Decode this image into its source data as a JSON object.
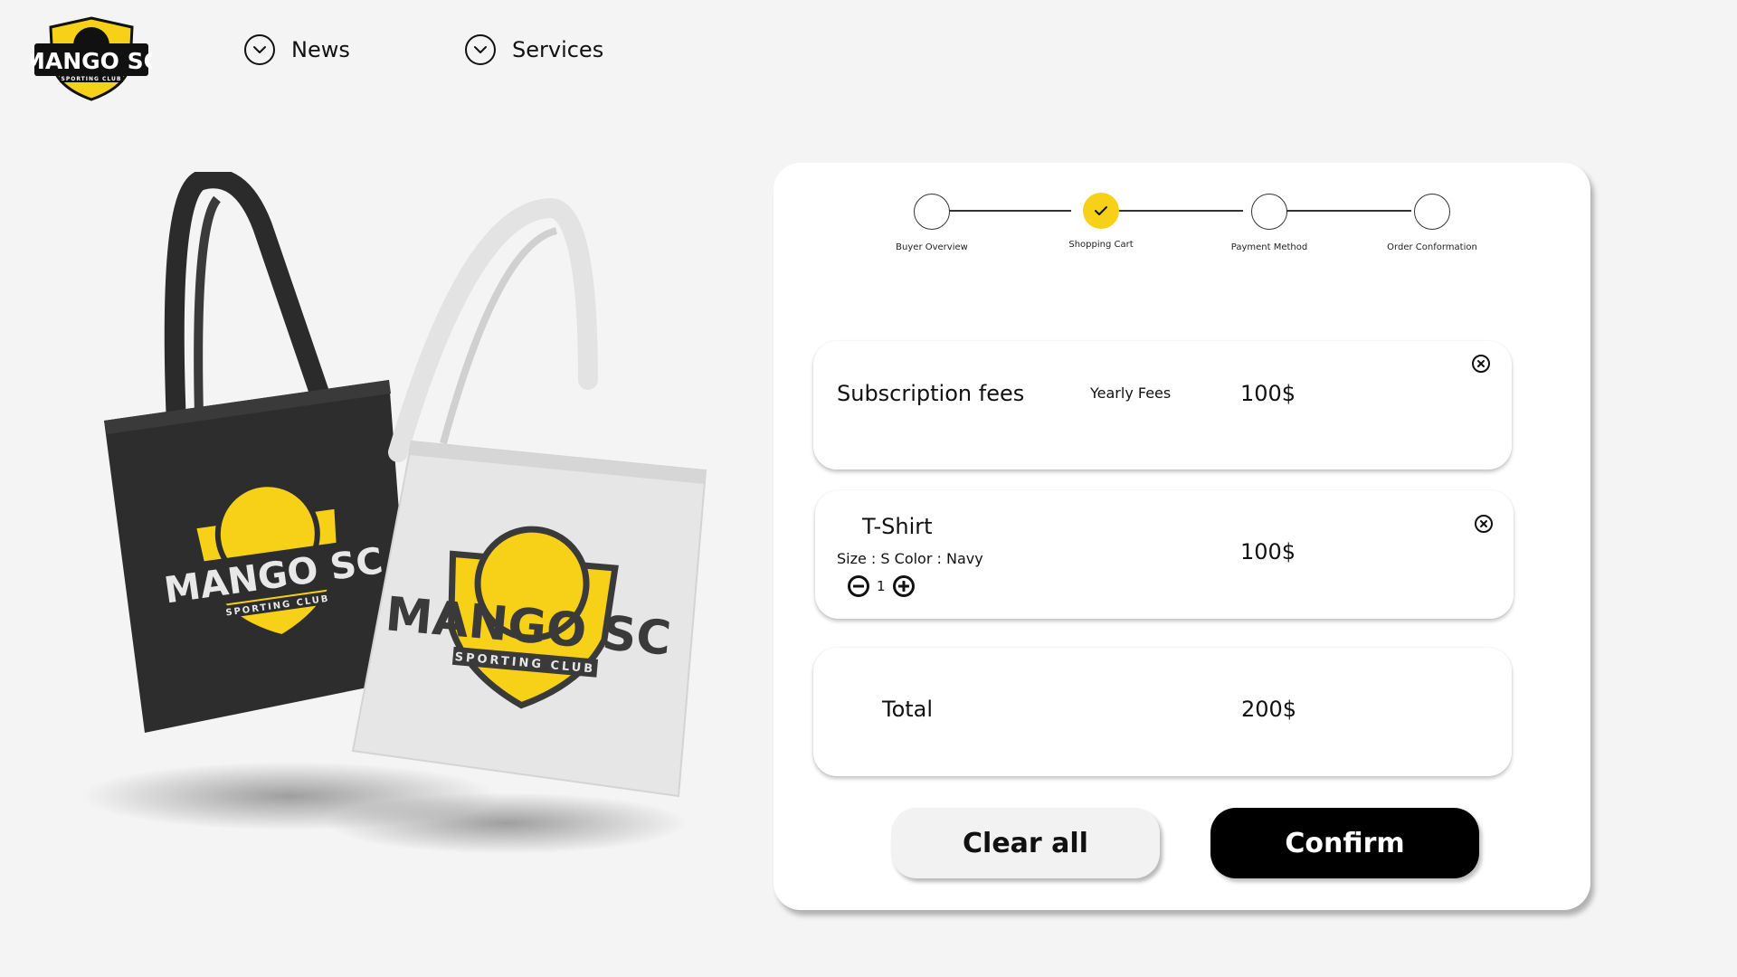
{
  "brand": {
    "logo_text": "MANGO SC",
    "logo_subtext": "SPORTING CLUB",
    "accent": "#f7d117"
  },
  "nav": {
    "items": [
      {
        "label": "News",
        "icon": "chevron-down-icon"
      },
      {
        "label": "Services",
        "icon": "chevron-down-icon"
      }
    ]
  },
  "stepper": {
    "steps": [
      {
        "label": "Buyer Overview",
        "state": "pending"
      },
      {
        "label": "Shopping Cart",
        "state": "active"
      },
      {
        "label": "Payment Method",
        "state": "pending"
      },
      {
        "label": "Order Conformation",
        "state": "pending"
      }
    ]
  },
  "cart": {
    "items": [
      {
        "name": "Subscription fees",
        "detail": "Yearly Fees",
        "price": "100$"
      },
      {
        "name": "T-Shirt",
        "detail": "Size : S Color : Navy",
        "quantity": "1",
        "price": "100$"
      }
    ],
    "total": {
      "label": "Total",
      "value": "200$"
    }
  },
  "actions": {
    "clear_label": "Clear all",
    "confirm_label": "Confirm"
  },
  "colors": {
    "background": "#f4f4f4",
    "card": "#ffffff",
    "confirm_bg": "#000000",
    "clear_bg": "#f2f2f2"
  }
}
